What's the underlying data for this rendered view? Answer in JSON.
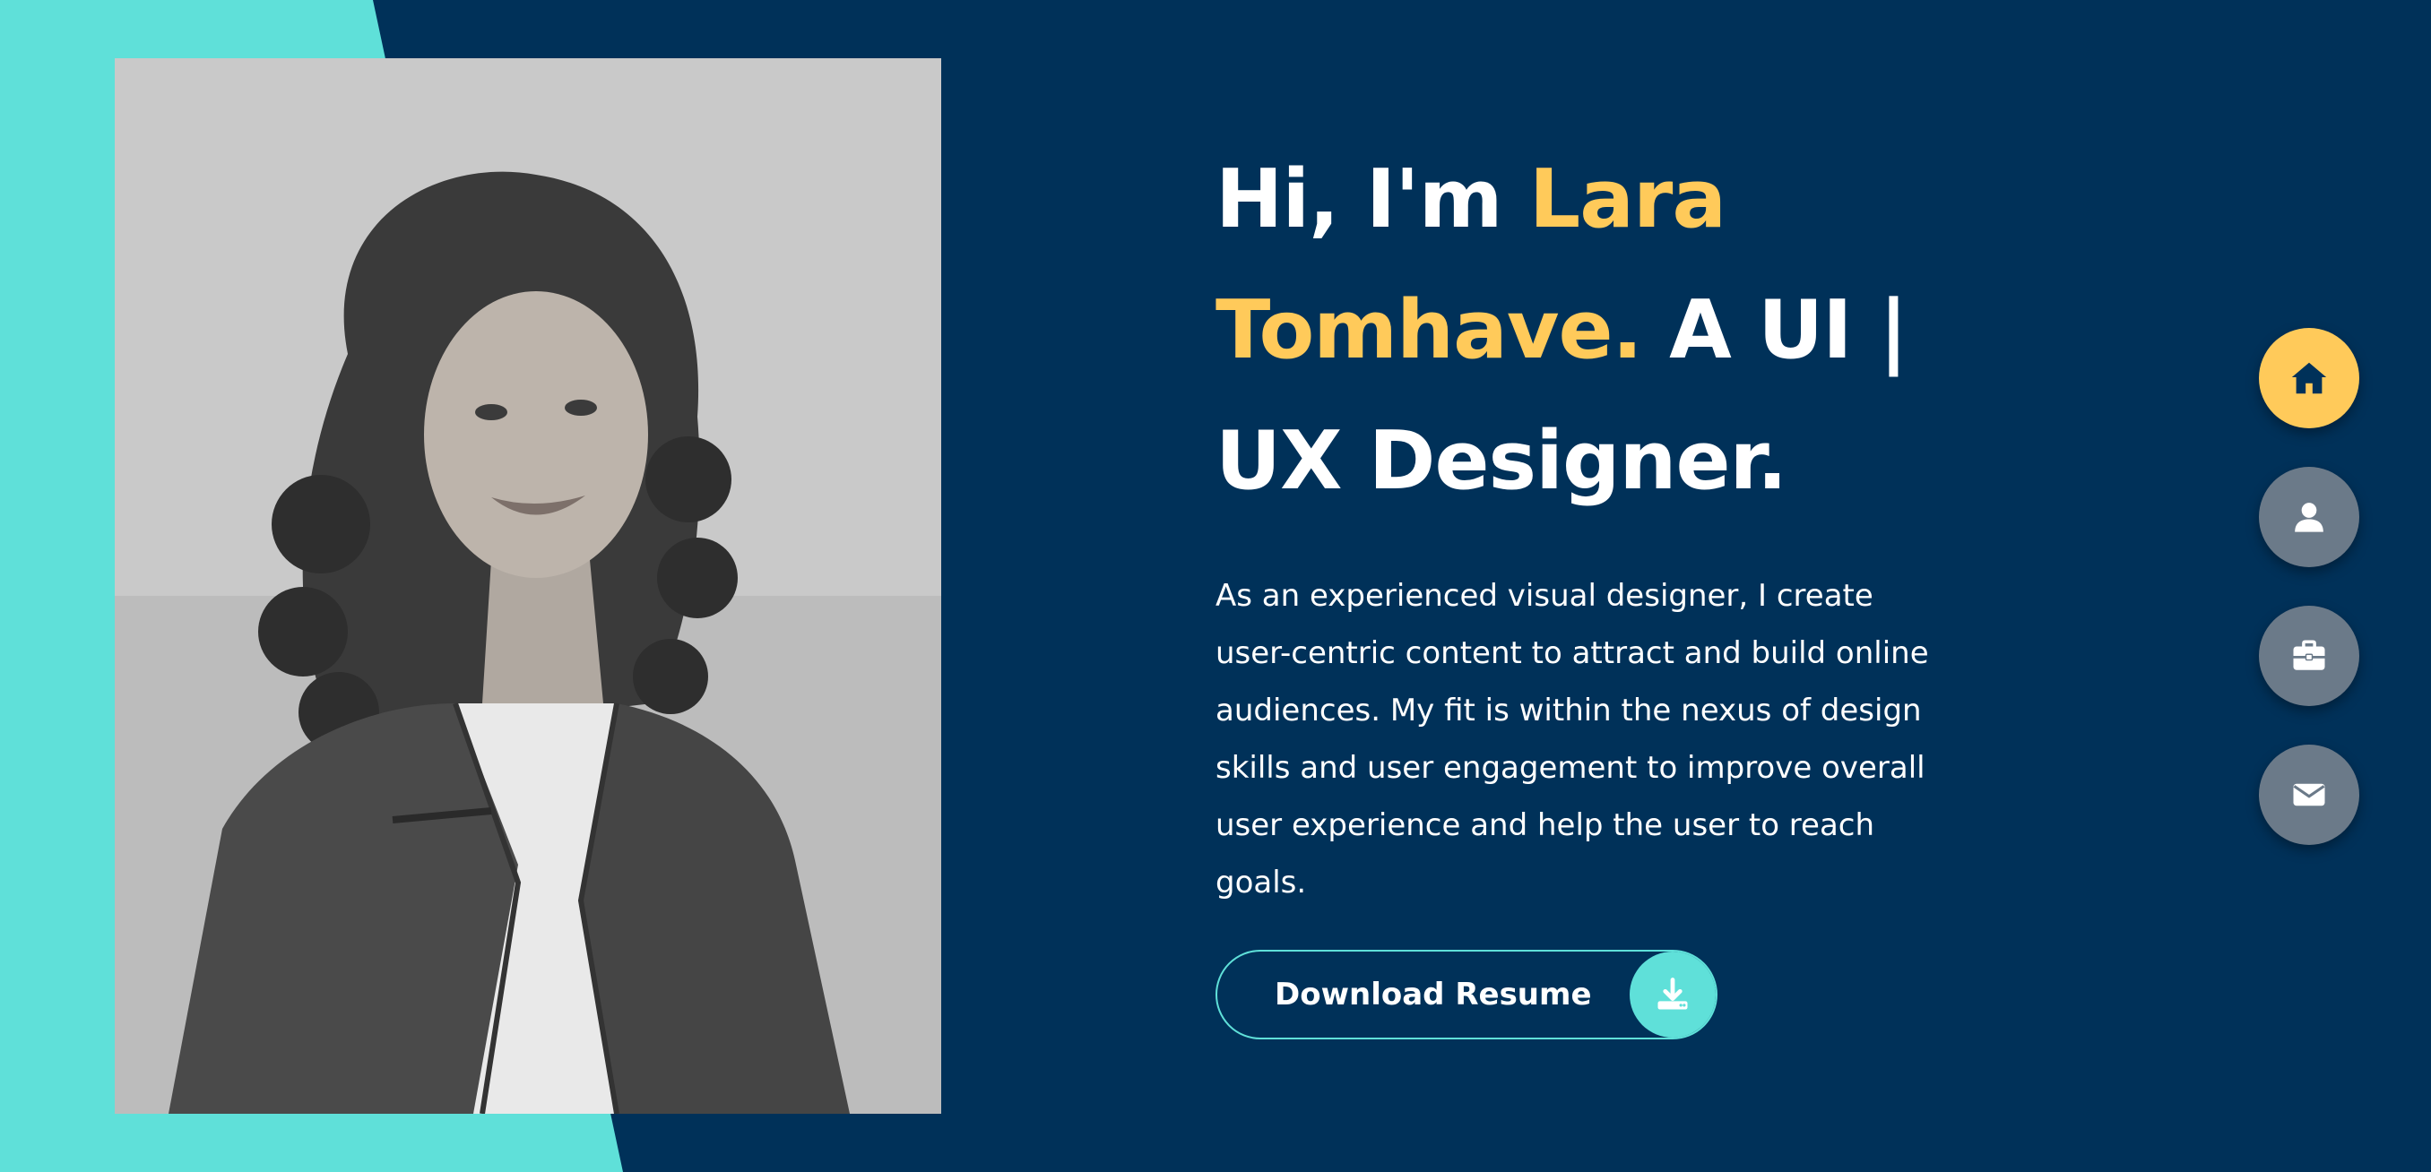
{
  "hero": {
    "greeting": "Hi, I'm ",
    "name": "Lara Tomhave.",
    "role": " A UI | UX Designer.",
    "bio": "As an experienced visual designer, I create user-centric content to attract and build online audiences. My fit is within the nexus of design skills and user engagement to improve overall user experience and help the user to reach goals."
  },
  "download": {
    "label": "Download Resume",
    "icon": "download-icon"
  },
  "nav": {
    "items": [
      {
        "icon": "home-icon",
        "active": true
      },
      {
        "icon": "user-icon",
        "active": false
      },
      {
        "icon": "briefcase-icon",
        "active": false
      },
      {
        "icon": "envelope-icon",
        "active": false
      }
    ]
  },
  "colors": {
    "background": "#003159",
    "teal": "#5fe0d9",
    "accent": "#ffca5a",
    "nav_inactive": "#6b7a89",
    "text": "#ffffff"
  },
  "portrait": {
    "style": "grayscale"
  }
}
